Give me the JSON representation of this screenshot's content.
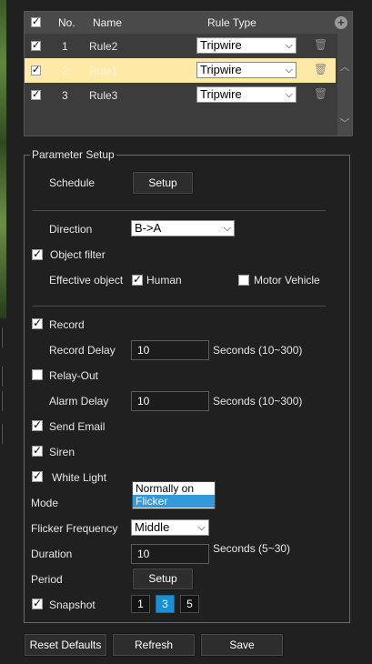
{
  "table": {
    "headers": {
      "no": "No.",
      "name": "Name",
      "rule_type": "Rule Type"
    },
    "rows": [
      {
        "no": "1",
        "name": "Rule2",
        "rule_type": "Tripwire"
      },
      {
        "no": "2",
        "name": "Rule1",
        "rule_type": "Tripwire"
      },
      {
        "no": "3",
        "name": "Rule3",
        "rule_type": "Tripwire"
      }
    ]
  },
  "params": {
    "legend": "Parameter Setup",
    "schedule": {
      "label": "Schedule",
      "button": "Setup"
    },
    "direction": {
      "label": "Direction",
      "value": "B->A"
    },
    "object_filter": {
      "label": "Object filter"
    },
    "effective_object": {
      "label": "Effective object",
      "human": "Human",
      "vehicle": "Motor Vehicle"
    },
    "record": {
      "label": "Record"
    },
    "record_delay": {
      "label": "Record Delay",
      "value": "10",
      "unit": "Seconds (10~300)"
    },
    "relay_out": {
      "label": "Relay-Out"
    },
    "alarm_delay": {
      "label": "Alarm Delay",
      "value": "10",
      "unit": "Seconds (10~300)"
    },
    "send_email": {
      "label": "Send Email"
    },
    "siren": {
      "label": "Siren"
    },
    "white_light": {
      "label": "White Light"
    },
    "mode": {
      "label": "Mode",
      "options": [
        "Normally on",
        "Flicker"
      ]
    },
    "flicker_frequency": {
      "label": "Flicker Frequency",
      "value": "Middle"
    },
    "duration": {
      "label": "Duration",
      "value": "10",
      "unit": "Seconds (5~30)"
    },
    "period": {
      "label": "Period",
      "button": "Setup"
    },
    "snapshot": {
      "label": "Snapshot",
      "options": [
        "1",
        "3",
        "5"
      ]
    }
  },
  "footer": {
    "reset": "Reset Defaults",
    "refresh": "Refresh",
    "save": "Save"
  }
}
